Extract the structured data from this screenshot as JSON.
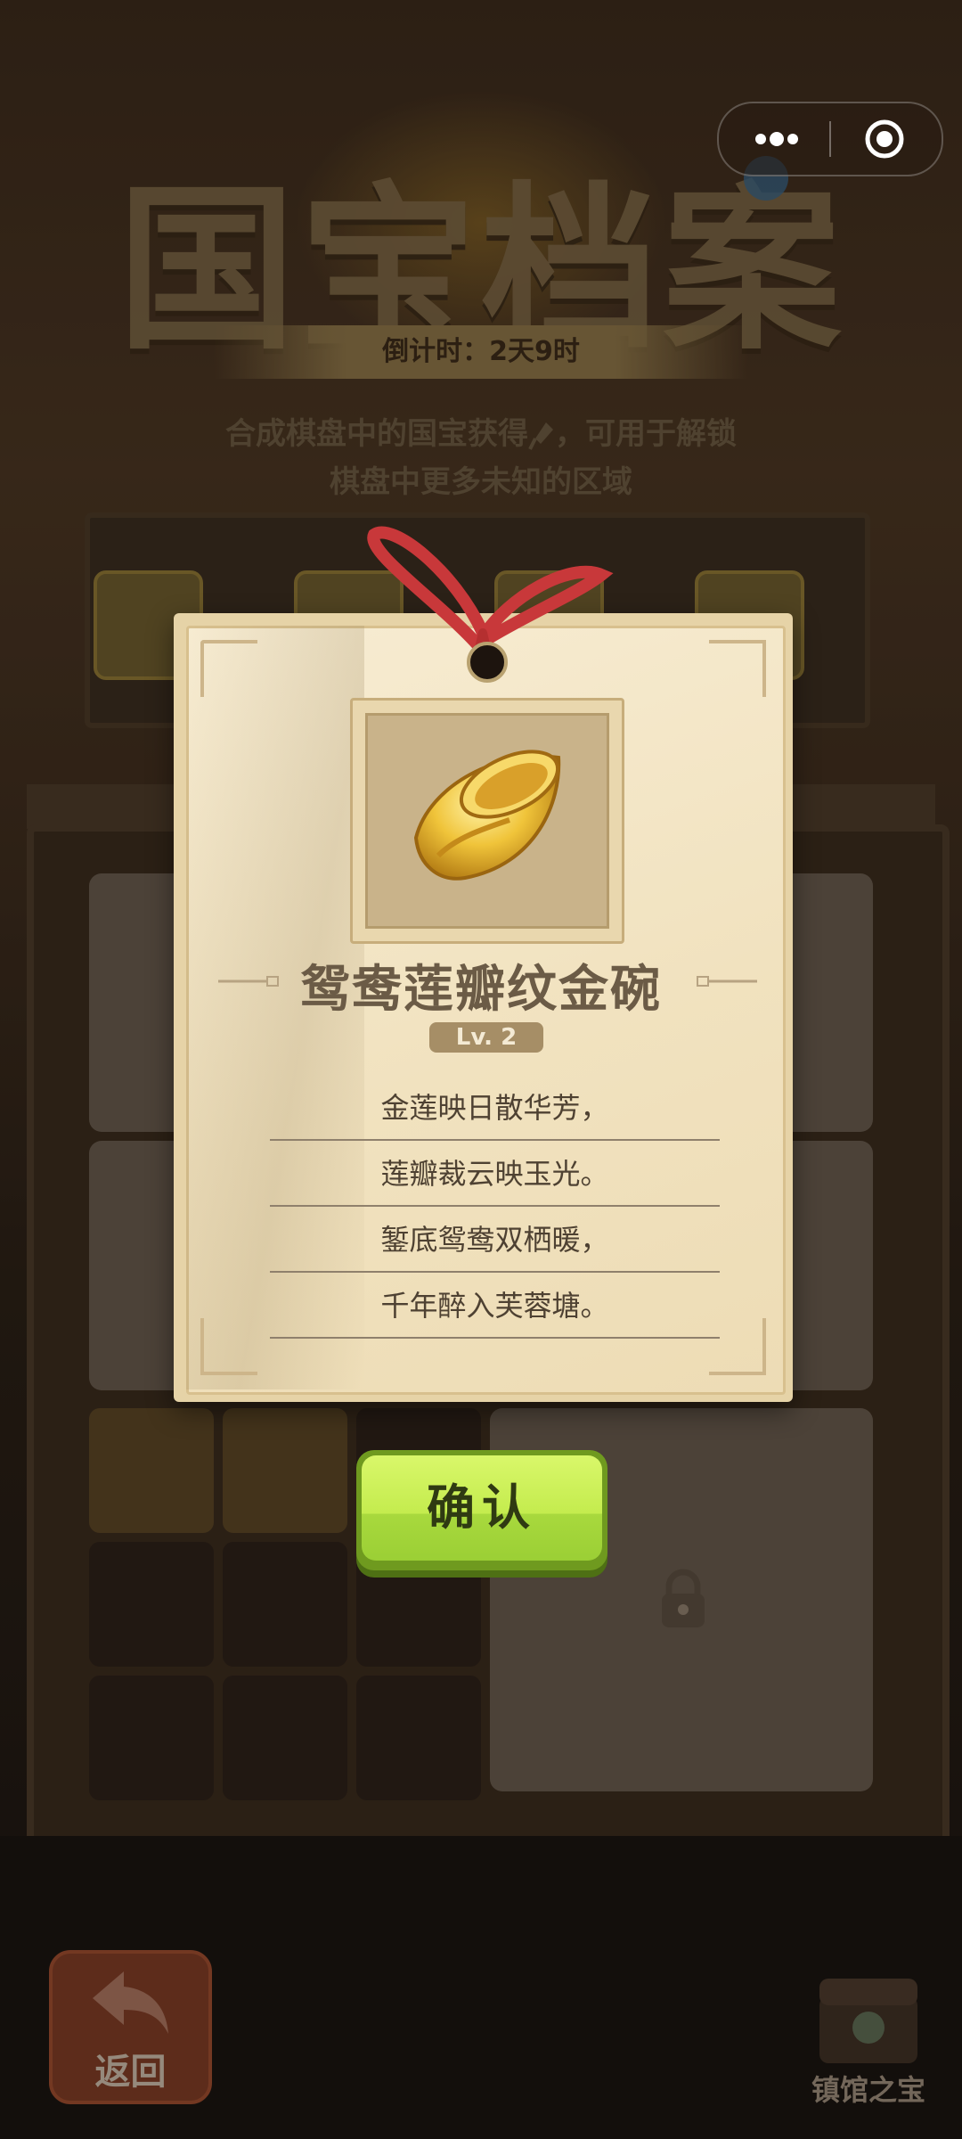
{
  "background": {
    "title": "国宝档案",
    "countdown": "倒计时：2天9时",
    "description_line1_before": "合成棋盘中的国宝获得",
    "description_line1_after": "，可用于解锁",
    "description_line2": "棋盘中更多未知的区域",
    "back_label": "返回",
    "treasure_label": "镇馆之宝",
    "icons": [
      "spade-icon",
      "lock-icon",
      "back-arrow-icon",
      "treasure-chest-icon"
    ]
  },
  "capsule": {
    "icons": [
      "more-icon",
      "close-target-icon"
    ]
  },
  "card": {
    "item_name": "鸳鸯莲瓣纹金碗",
    "level": "Lv. 2",
    "poem": [
      "金莲映日散华芳，",
      "莲瓣裁云映玉光。",
      "錾底鸳鸯双栖暖，",
      "千年醉入芙蓉塘。"
    ]
  },
  "confirm_button": {
    "label": "确认"
  },
  "colors": {
    "card_paper": "#f1e2bf",
    "confirm_green": "#c4ec4e",
    "ribbon_red": "#c8383a",
    "gold": "#e8b530"
  }
}
